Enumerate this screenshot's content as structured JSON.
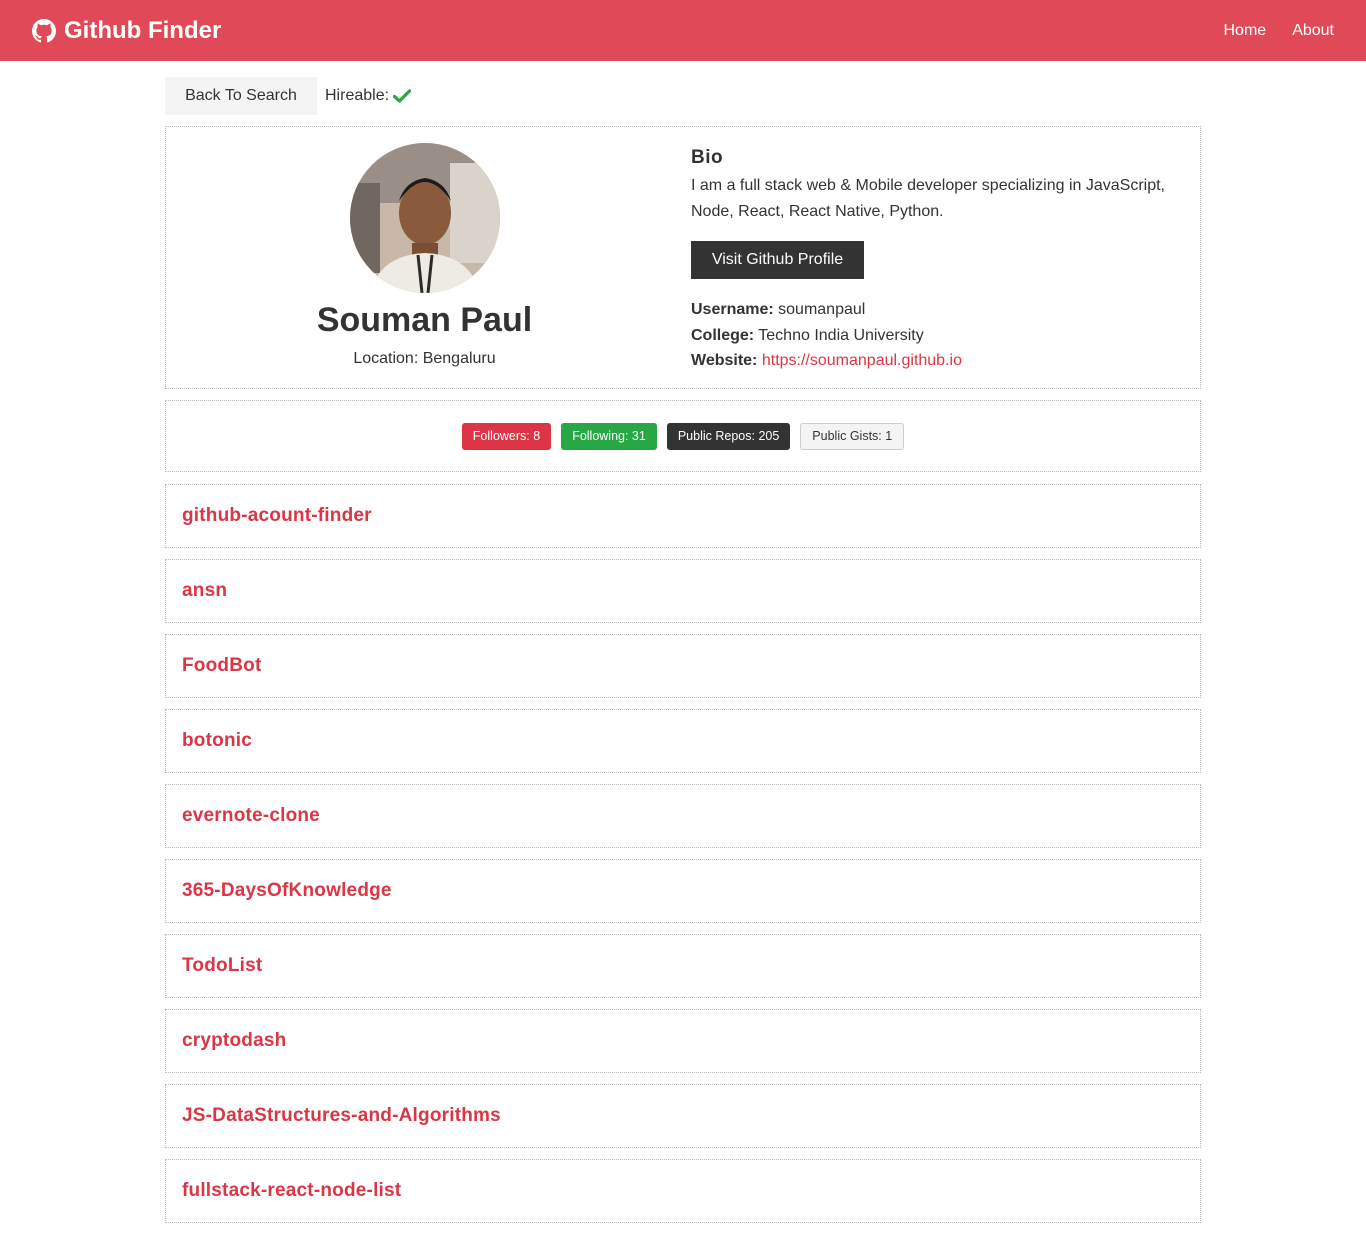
{
  "navbar": {
    "brand": "Github Finder",
    "links": [
      "Home",
      "About"
    ]
  },
  "top": {
    "back_label": "Back To Search",
    "hireable_label": "Hireable:"
  },
  "profile": {
    "name": "Souman Paul",
    "location": "Location: Bengaluru",
    "bio_title": "Bio",
    "bio": "I am a full stack web & Mobile developer specializing in JavaScript, Node, React, React Native, Python.",
    "visit_label": "Visit Github Profile",
    "username_label": "Username:",
    "username": "soumanpaul",
    "college_label": "College:",
    "college": "Techno India University",
    "website_label": "Website:",
    "website": "https://soumanpaul.github.io"
  },
  "stats": {
    "followers": "Followers: 8",
    "following": "Following: 31",
    "repos": "Public Repos: 205",
    "gists": "Public Gists: 1"
  },
  "repos": [
    "github-acount-finder",
    "ansn",
    "FoodBot",
    "botonic",
    "evernote-clone",
    "365-DaysOfKnowledge",
    "TodoList",
    "cryptodash",
    "JS-DataStructures-and-Algorithms",
    "fullstack-react-node-list"
  ],
  "colors": {
    "brand": "#e04a58",
    "link": "#dc3545",
    "success": "#28a745",
    "dark": "#333333"
  },
  "icons": {
    "brand": "github-icon",
    "hireable": "check-icon"
  }
}
